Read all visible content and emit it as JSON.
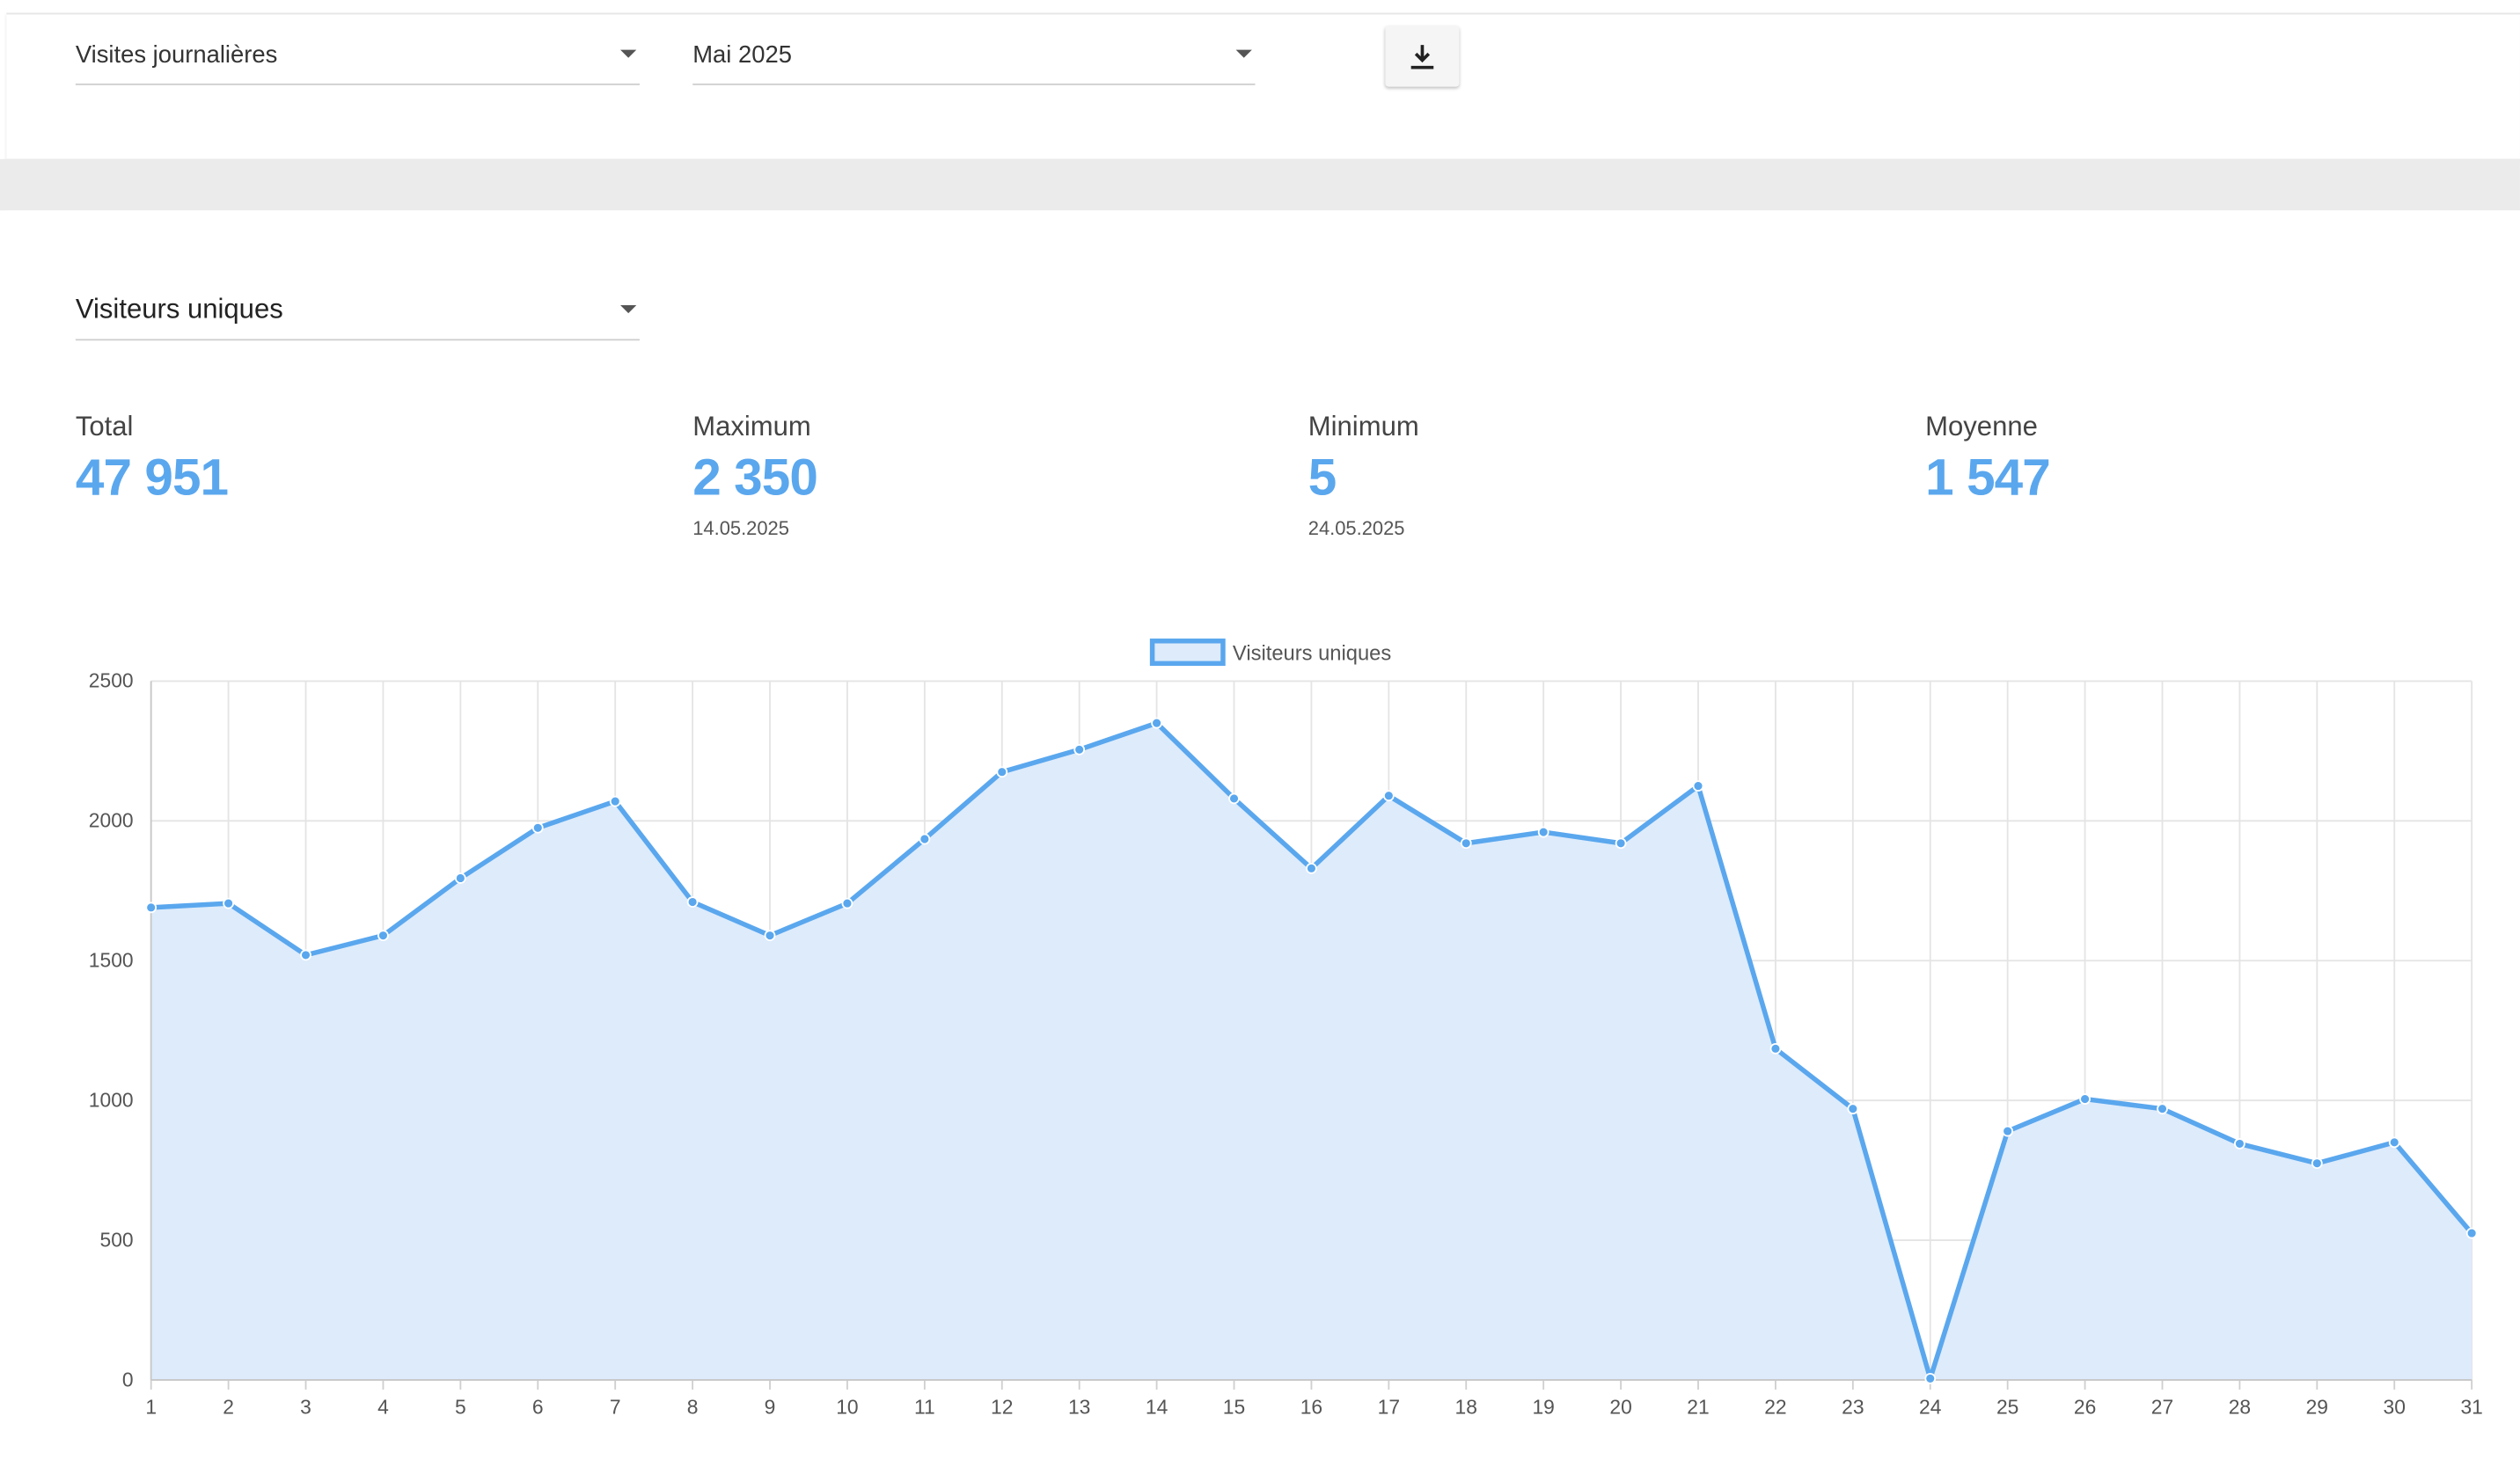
{
  "filters": {
    "metric_select": "Visites journalières",
    "period_select": "Mai 2025",
    "download_icon": "download-icon"
  },
  "series_select": "Visiteurs uniques",
  "stats": {
    "total": {
      "label": "Total",
      "value": "47 951"
    },
    "maximum": {
      "label": "Maximum",
      "value": "2 350",
      "date": "14.05.2025"
    },
    "minimum": {
      "label": "Minimum",
      "value": "5",
      "date": "24.05.2025"
    },
    "average": {
      "label": "Moyenne",
      "value": "1 547"
    }
  },
  "colors": {
    "accent": "#5aa7ee",
    "area_fill": "#ddebfb",
    "grid": "#e4e4e4"
  },
  "chart_data": {
    "type": "area",
    "legend_position": "top-center",
    "grid": true,
    "x": [
      "1",
      "2",
      "3",
      "4",
      "5",
      "6",
      "7",
      "8",
      "9",
      "10",
      "11",
      "12",
      "13",
      "14",
      "15",
      "16",
      "17",
      "18",
      "19",
      "20",
      "21",
      "22",
      "23",
      "24",
      "25",
      "26",
      "27",
      "28",
      "29",
      "30",
      "31"
    ],
    "ylim": [
      0,
      2500
    ],
    "yticks": [
      0,
      500,
      1000,
      1500,
      2000,
      2500
    ],
    "series": [
      {
        "name": "Visiteurs uniques",
        "values": [
          1690,
          1705,
          1520,
          1590,
          1795,
          1975,
          2070,
          1710,
          1590,
          1705,
          1935,
          2175,
          2255,
          2350,
          2080,
          1830,
          2090,
          1920,
          1960,
          1920,
          2125,
          1185,
          970,
          5,
          890,
          1005,
          970,
          845,
          775,
          850,
          525
        ]
      }
    ]
  }
}
